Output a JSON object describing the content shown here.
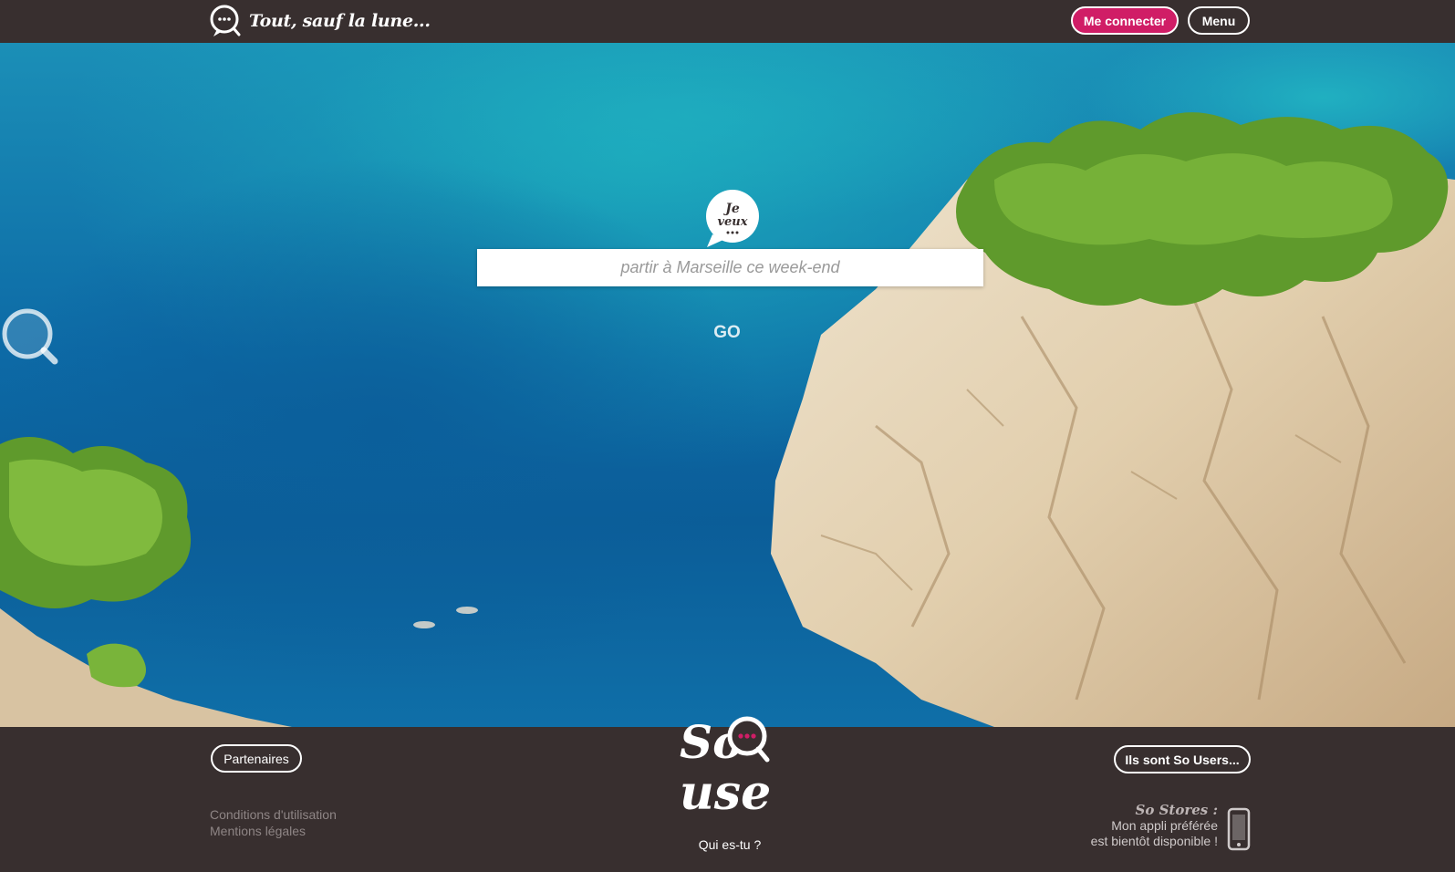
{
  "header": {
    "tagline": "Tout, sauf la lune...",
    "login_label": "Me connecter",
    "menu_label": "Menu"
  },
  "hero": {
    "bubble_line1": "Je",
    "bubble_line2": "veux",
    "search_placeholder": "partir à Marseille ce week-end",
    "go_label": "GO"
  },
  "footer": {
    "partners_label": "Partenaires",
    "users_label": "Ils sont So Users...",
    "links": [
      "Conditions d'utilisation",
      "Mentions légales"
    ],
    "logo_line1": "So",
    "logo_line2": "use",
    "quiestu_label": "Qui es-tu ?",
    "stores_title": "So Stores :",
    "stores_line1": "Mon appli préférée",
    "stores_line2": "est bientôt disponible !"
  },
  "colors": {
    "dark_bar": "#382f2f",
    "accent_pink": "#d01d66",
    "sea_blue": "#0d6aa6"
  }
}
